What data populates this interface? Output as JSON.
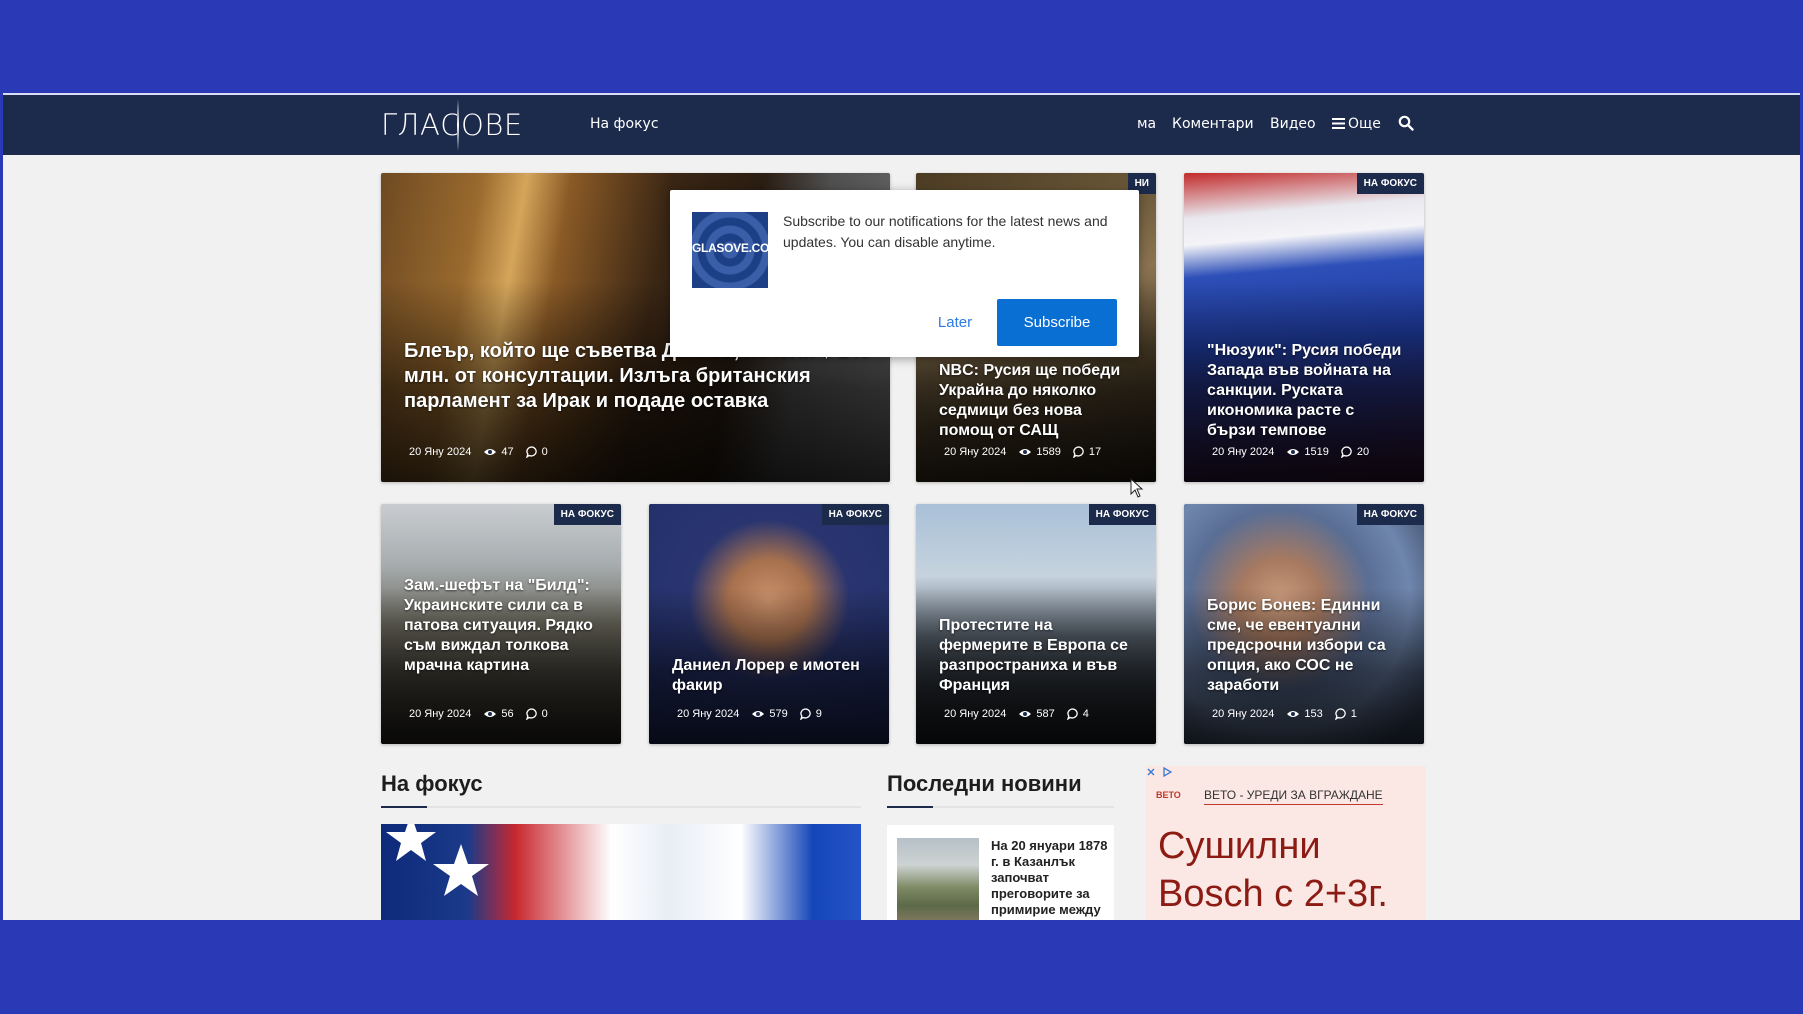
{
  "header": {
    "logo": "ГЛАСОВЕ",
    "nav": [
      {
        "label": "На фокус"
      },
      {
        "label": "ма"
      },
      {
        "label": "Коментари"
      },
      {
        "label": "Видео"
      },
      {
        "label": "Още"
      }
    ]
  },
  "cards": [
    {
      "tag": "",
      "title": "Блеър, който ще съветва Денков, печели $ 140 млн. от консултации. Излъга британския парламент за Ирак и подаде оставка",
      "date": "20 Яну 2024",
      "views": "47",
      "comments": "0"
    },
    {
      "tag": "НИ",
      "title": "NBC: Русия ще победи Украйна до няколко седмици без нова помощ от САЩ",
      "date": "20 Яну 2024",
      "views": "1589",
      "comments": "17"
    },
    {
      "tag": "НА ФОКУС",
      "title": "\"Нюзуик\": Русия победи Запада във войната на санкции. Руската икономика расте с бързи темпове",
      "date": "20 Яну 2024",
      "views": "1519",
      "comments": "20"
    },
    {
      "tag": "НА ФОКУС",
      "title": "Зам.-шефът на \"Билд\": Украинските сили са в патова ситуация. Рядко съм виждал толкова мрачна картина",
      "date": "20 Яну 2024",
      "views": "56",
      "comments": "0"
    },
    {
      "tag": "НА ФОКУС",
      "title": "Даниел Лорер е имотен факир",
      "date": "20 Яну 2024",
      "views": "579",
      "comments": "9"
    },
    {
      "tag": "НА ФОКУС",
      "title": "Протестите на фермерите в Европа се разпространиха и във Франция",
      "date": "20 Яну 2024",
      "views": "587",
      "comments": "4"
    },
    {
      "tag": "НА ФОКУС",
      "title": "Борис Бонев: Единни сме, че евентуални предсрочни избори са опция, ако СОС не заработи",
      "date": "20 Яну 2024",
      "views": "153",
      "comments": "1"
    }
  ],
  "sections": {
    "focus": "На фокус",
    "latest": "Последни новини"
  },
  "latest_item": {
    "text": "На 20 януари 1878 г. в Казанлък започват преговорите за примирие между"
  },
  "ad": {
    "brand": "ВЕТО",
    "source": "ВЕТО - УРЕДИ ЗА ВГРАЖДАНЕ",
    "headline": "Сушилни Bosch с 2+3г."
  },
  "popup": {
    "logo_text": "GLASOVE.COM",
    "message": "Subscribe to our notifications for the latest news and updates. You can disable anytime.",
    "later": "Later",
    "subscribe": "Subscribe"
  }
}
